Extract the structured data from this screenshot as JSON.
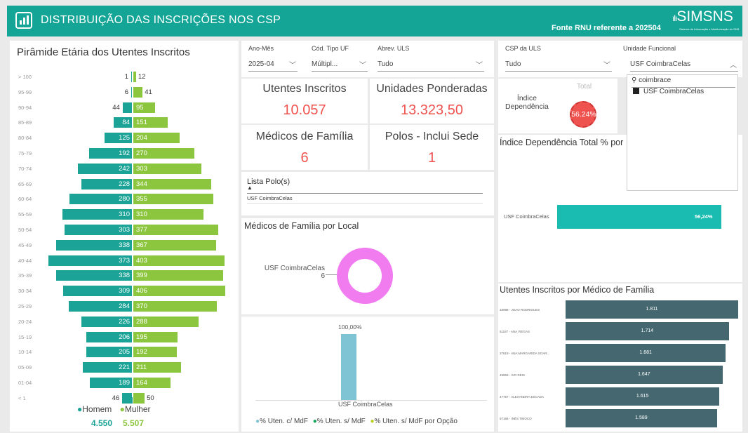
{
  "header": {
    "title": "DISTRIBUIÇÃO DAS INSCRIÇÕES NOS CSP",
    "fonte": "Fonte RNU referente a 202504",
    "brand": "SIMSNS",
    "brand_sub": "Sistema de Informação e Monitorização do SNS"
  },
  "pyramid": {
    "title": "Pirâmide Etária dos Utentes Inscritos",
    "rows": [
      {
        "age": "> 100",
        "m": 1,
        "f": 12
      },
      {
        "age": "95-99",
        "m": 6,
        "f": 41
      },
      {
        "age": "90-94",
        "m": 44,
        "f": 95
      },
      {
        "age": "85-89",
        "m": 84,
        "f": 151
      },
      {
        "age": "80-84",
        "m": 125,
        "f": 204
      },
      {
        "age": "75-79",
        "m": 192,
        "f": 270
      },
      {
        "age": "70-74",
        "m": 242,
        "f": 303
      },
      {
        "age": "65-69",
        "m": 228,
        "f": 344
      },
      {
        "age": "60-64",
        "m": 280,
        "f": 355
      },
      {
        "age": "55-59",
        "m": 310,
        "f": 310
      },
      {
        "age": "50-54",
        "m": 303,
        "f": 377
      },
      {
        "age": "45-49",
        "m": 338,
        "f": 367
      },
      {
        "age": "40-44",
        "m": 373,
        "f": 403
      },
      {
        "age": "35-39",
        "m": 338,
        "f": 399
      },
      {
        "age": "30-34",
        "m": 309,
        "f": 406
      },
      {
        "age": "25-29",
        "m": 284,
        "f": 370
      },
      {
        "age": "20-24",
        "m": 226,
        "f": 288
      },
      {
        "age": "15-19",
        "m": 206,
        "f": 195
      },
      {
        "age": "10-14",
        "m": 205,
        "f": 192
      },
      {
        "age": "05-09",
        "m": 221,
        "f": 211
      },
      {
        "age": "01-04",
        "m": 189,
        "f": 164
      },
      {
        "age": "< 1",
        "m": 46,
        "f": 50
      }
    ],
    "legend_male": "Homem",
    "legend_female": "Mulher",
    "total_male": "4.550",
    "total_female": "5.507",
    "color_male": "#1aa396",
    "color_female": "#8cc63f"
  },
  "filters": {
    "ano_mes": {
      "label": "Ano-Mês",
      "value": "2025-04"
    },
    "tipo_uf": {
      "label": "Cód. Tipo UF",
      "value": "Múltipl..."
    },
    "uls": {
      "label": "Abrev. ULS",
      "value": "Tudo"
    },
    "csp": {
      "label": "CSP da ULS",
      "value": "Tudo"
    },
    "uf": {
      "label": "Unidade Funcional",
      "value": "USF CoimbraCelas",
      "search_text": "coimbrace",
      "options": [
        "USF CoimbraCelas"
      ]
    }
  },
  "kpis": {
    "utentes": {
      "title": "Utentes Inscritos",
      "value": "10.057"
    },
    "ponderadas": {
      "title": "Unidades Ponderadas",
      "value": "13.323,50"
    },
    "medicos": {
      "title": "Médicos de Família",
      "value": "6"
    },
    "polos": {
      "title": "Polos - Inclui Sede",
      "value": "1"
    }
  },
  "indice": {
    "label_line1": "Índice",
    "label_line2": "Dependência",
    "total_label": "Total",
    "value": "56.24%"
  },
  "polo_list": {
    "title": "Lista Polo(s)",
    "items": [
      "USF CoimbraCelas"
    ]
  },
  "medicos_local": {
    "title": "Médicos de Família por Local",
    "label": "USF CoimbraCelas",
    "value": "6",
    "color": "#f07cf0"
  },
  "pct_chart": {
    "value_label": "100,00%",
    "category": "USF CoimbraCelas",
    "legend": [
      "% Uten. c/ MdF",
      "% Uten. s/ MdF",
      "% Uten. s/ MdF por Opção"
    ],
    "legend_colors": [
      "#7fc4d5",
      "#14a55c",
      "#b8cf1c"
    ]
  },
  "indice_chart": {
    "title": "Índice Dependência Total % por",
    "label": "USF CoimbraCelas",
    "value_label": "56,24%"
  },
  "mdf_chart": {
    "title": "Utentes Inscritos por Médico de Família",
    "rows": [
      {
        "name": "33998 - JOAO RODRIGUES",
        "value": 1811,
        "label": "1.811"
      },
      {
        "name": "51187 - ANA VIEGAS",
        "value": 1714,
        "label": "1.714"
      },
      {
        "name": "37619 - ANA MARGARIDA SOAR...",
        "value": 1681,
        "label": "1.681"
      },
      {
        "name": "49963 - IVO REIS",
        "value": 1647,
        "label": "1.647"
      },
      {
        "name": "47757 - ALEXANDRA ESCADA",
        "value": 1615,
        "label": "1.615"
      },
      {
        "name": "57166 - INÊS TINOCO",
        "value": 1589,
        "label": "1.589"
      }
    ]
  }
}
